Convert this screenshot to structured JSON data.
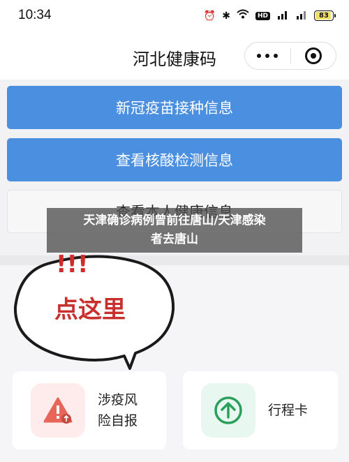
{
  "status_bar": {
    "time": "10:34",
    "battery": "83",
    "battery_level": 0.83
  },
  "nav": {
    "title": "河北健康码",
    "more_icon": "more-dots-icon",
    "close_icon": "target-icon"
  },
  "buttons": {
    "vaccine": "新冠疫苗接种信息",
    "nucleic": "查看核酸检测信息",
    "health": "查看本人健康信息"
  },
  "caption": {
    "line1": "天津确诊病例曾前往唐山/天津感染",
    "line2": "者去唐山"
  },
  "bubble": {
    "exclaim": "!!!",
    "text": "点这里"
  },
  "cards": [
    {
      "label_line1": "涉疫风",
      "label_line2": "险自报",
      "icon": "warning-icon",
      "icon_color": "#e8655a"
    },
    {
      "label": "行程卡",
      "icon": "arrow-up-circle-icon",
      "icon_color": "#2aa05c"
    }
  ],
  "colors": {
    "primary_button": "#4a8fe0",
    "caption_bg": "#505050"
  }
}
